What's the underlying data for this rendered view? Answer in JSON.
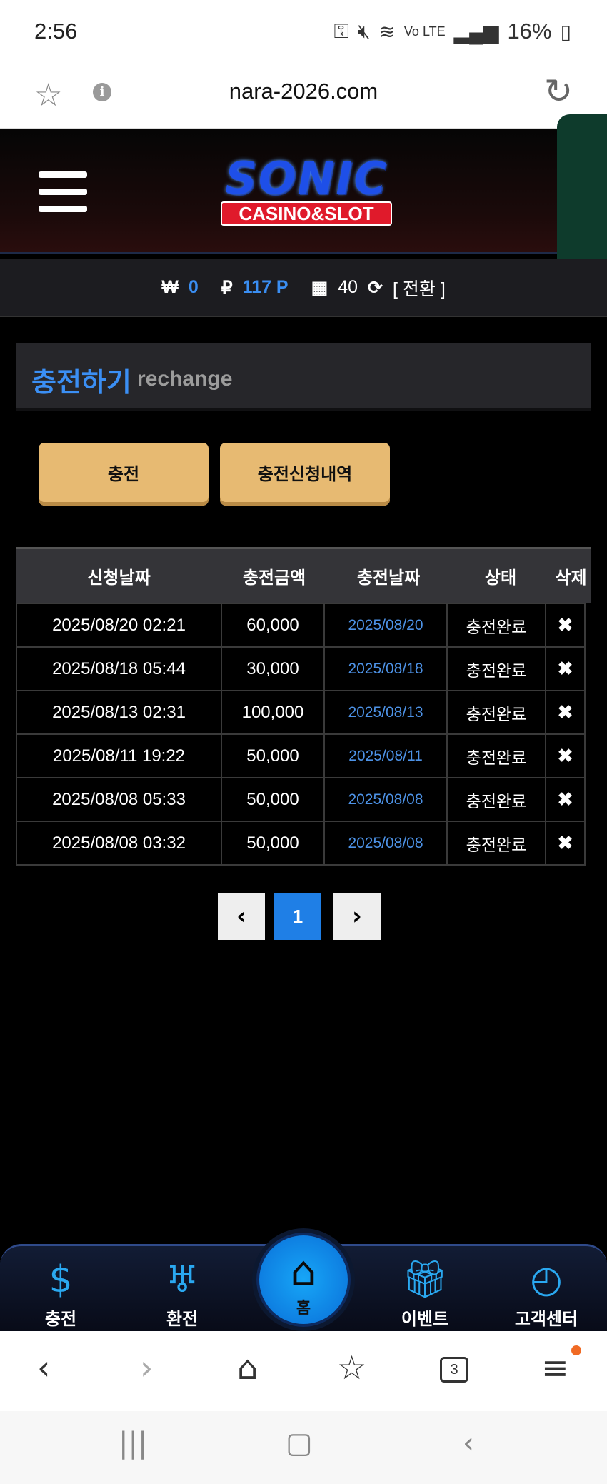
{
  "status_bar": {
    "time": "2:56",
    "battery": "16%"
  },
  "browser": {
    "url": "nara-2026.com",
    "tab_count": "3"
  },
  "site": {
    "logo_main": "SONIC",
    "logo_sub": "CASINO&SLOT"
  },
  "balance": {
    "won_symbol": "₩",
    "won_value": "0",
    "point_symbol": "₽",
    "point_value": "117 P",
    "ticket_value": "40",
    "convert_label": "[ 전환 ]"
  },
  "page": {
    "title_ko": "충전하기",
    "title_en": "rechange"
  },
  "actions": {
    "charge_button": "충전",
    "history_button": "충전신청내역"
  },
  "table": {
    "headers": [
      "신청날짜",
      "충전금액",
      "충전날짜",
      "상태",
      "삭제"
    ],
    "rows": [
      [
        "2025/08/20 02:21",
        "60,000",
        "2025/08/20",
        "충전완료",
        "✖"
      ],
      [
        "2025/08/18 05:44",
        "30,000",
        "2025/08/18",
        "충전완료",
        "✖"
      ],
      [
        "2025/08/13 02:31",
        "100,000",
        "2025/08/13",
        "충전완료",
        "✖"
      ],
      [
        "2025/08/11 19:22",
        "50,000",
        "2025/08/11",
        "충전완료",
        "✖"
      ],
      [
        "2025/08/08 05:33",
        "50,000",
        "2025/08/08",
        "충전완료",
        "✖"
      ],
      [
        "2025/08/08 03:32",
        "50,000",
        "2025/08/08",
        "충전완료",
        "✖"
      ]
    ]
  },
  "pagination": {
    "prev": "‹",
    "current": "1",
    "next": "›"
  },
  "bottom_nav": {
    "charge": "충전",
    "exchange": "환전",
    "home": "홈",
    "event": "이벤트",
    "support": "고객센터"
  },
  "icons": {
    "star": "star-icon",
    "info": "info-icon",
    "reload": "reload-icon",
    "menu": "hamburger-icon"
  },
  "colors": {
    "accent_blue": "#3b8ff4",
    "button_gold": "#e7ba72",
    "page_active": "#1f7fe6"
  }
}
